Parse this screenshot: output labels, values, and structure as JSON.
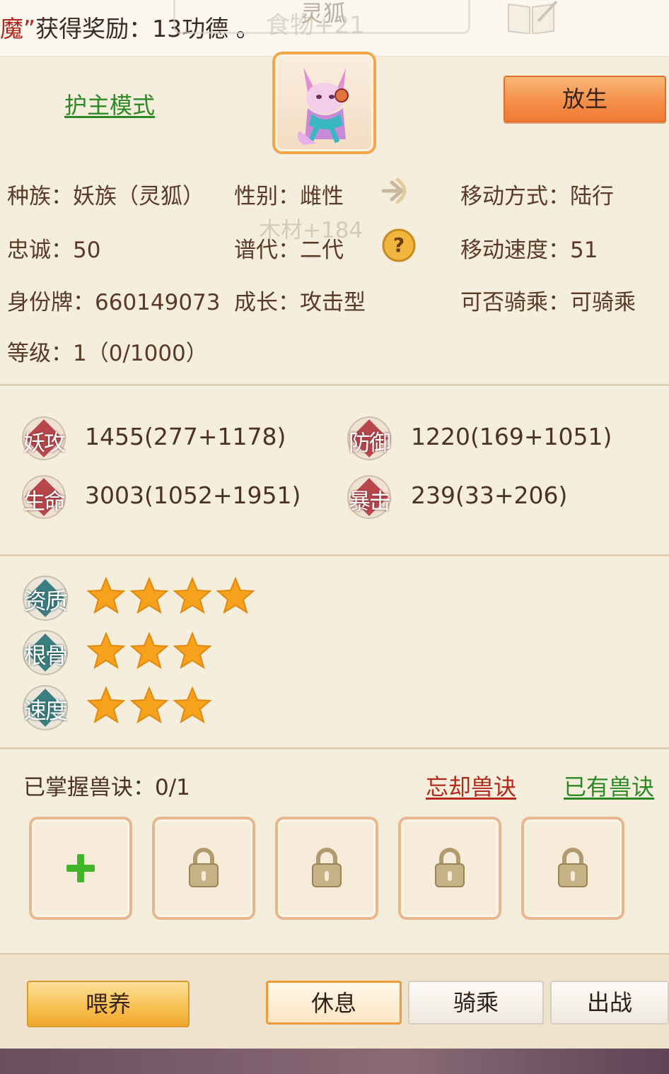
{
  "header": {
    "reward_prefix": "魔”",
    "reward_text": "获得奖励：13功德 。",
    "pet_name": "灵狐",
    "faded_text": "食物+21"
  },
  "top": {
    "guard_mode_link": "护主模式",
    "release_button": "放生"
  },
  "info": {
    "race": "种族：妖族（灵狐）",
    "gender": "性别：雌性",
    "move_type": "移动方式：陆行",
    "loyalty": "忠诚：50",
    "generation": "谱代：二代",
    "move_speed": "移动速度：51",
    "id_tag": "身份牌：660149073",
    "growth": "成长：攻击型",
    "rideable": "可否骑乘：可骑乘",
    "level": "等级：1（0/1000）",
    "floating_text": "木材+184"
  },
  "stats": {
    "attack": {
      "label": "妖攻",
      "value": "1455(277+1178)"
    },
    "defense": {
      "label": "防御",
      "value": "1220(169+1051)"
    },
    "hp": {
      "label": "生命",
      "value": "3003(1052+1951)"
    },
    "crit": {
      "label": "暴击",
      "value": "239(33+206)"
    }
  },
  "qualities": [
    {
      "label": "资质",
      "stars": 4
    },
    {
      "label": "根骨",
      "stars": 3
    },
    {
      "label": "速度",
      "stars": 3
    }
  ],
  "skills": {
    "mastered": "已掌握兽诀：0/1",
    "forget_link": "忘却兽诀",
    "owned_link": "已有兽诀"
  },
  "bottom": {
    "feed_button": "喂养",
    "rest_button": "休息",
    "ride_button": "骑乘",
    "battle_button": "出战"
  },
  "colors": {
    "accent_orange": "#f38d47",
    "link_green": "#2b8a25",
    "link_red": "#b22a1c",
    "star_gold": "#f6a21c"
  }
}
